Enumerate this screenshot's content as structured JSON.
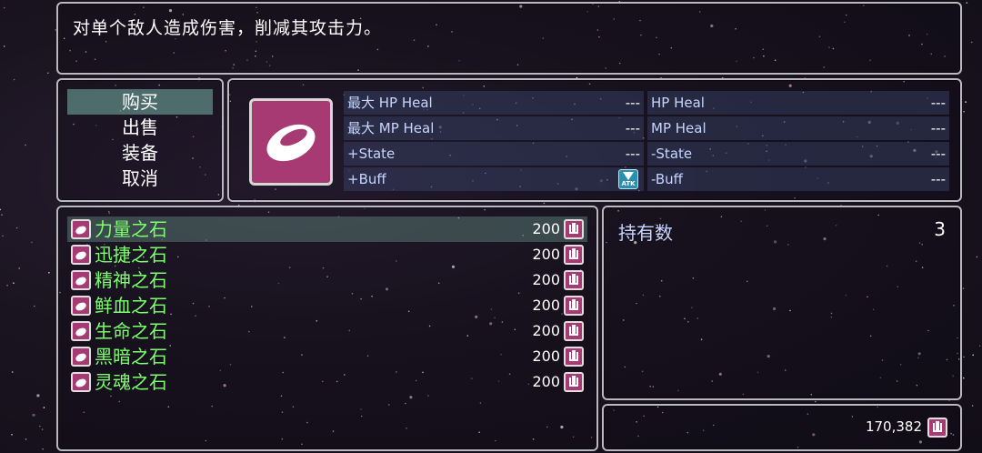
{
  "help": {
    "text": "对单个敌人造成伤害，削减其攻击力。"
  },
  "command": {
    "items": [
      "购买",
      "出售",
      "装备",
      "取消"
    ],
    "selected": 0
  },
  "status": {
    "rows": [
      {
        "left_label": "最大 HP Heal",
        "left_value": "---",
        "right_label": "HP Heal",
        "right_value": "---"
      },
      {
        "left_label": "最大 MP Heal",
        "left_value": "---",
        "right_label": "MP Heal",
        "right_value": "---"
      },
      {
        "left_label": "+State",
        "left_value": "---",
        "right_label": "-State",
        "right_value": "---"
      },
      {
        "left_label": "+Buff",
        "left_value": "ATK",
        "right_label": "-Buff",
        "right_value": "---"
      }
    ]
  },
  "items": [
    {
      "name": "力量之石",
      "price": "200"
    },
    {
      "name": "迅捷之石",
      "price": "200"
    },
    {
      "name": "精神之石",
      "price": "200"
    },
    {
      "name": "鲜血之石",
      "price": "200"
    },
    {
      "name": "生命之石",
      "price": "200"
    },
    {
      "name": "黑暗之石",
      "price": "200"
    },
    {
      "name": "灵魂之石",
      "price": "200"
    }
  ],
  "selected_item": 0,
  "possession": {
    "label": "持有数",
    "count": "3"
  },
  "gold": {
    "value": "170,382"
  },
  "colors": {
    "item_name": "#7dff6e",
    "icon_bg": "#a73a73",
    "selection": "#78b4aa"
  }
}
